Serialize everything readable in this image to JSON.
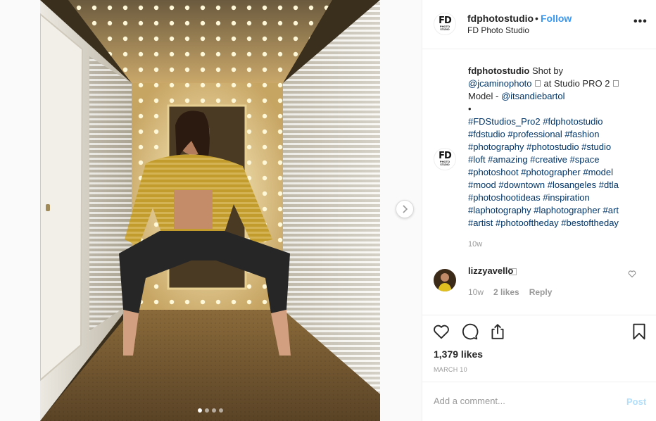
{
  "post": {
    "username": "fdphotostudio",
    "bullet": "•",
    "follow": "Follow",
    "full_name": "FD Photo Studio",
    "more": "•••",
    "avatar_text": {
      "big": "FD",
      "line1": "PHOTO",
      "line2": "STUDIO"
    }
  },
  "caption": {
    "username": "fdphotostudio",
    "text_lines": [
      {
        "pre": " Shot by",
        "link": "",
        "post": ""
      },
      {
        "pre": "",
        "link": "@jcaminophoto",
        "post": " ⃞ at Studio PRO 2 ⃞"
      },
      {
        "pre": "Model - ",
        "link": "@itsandiebartol",
        "post": ""
      },
      {
        "pre": "•",
        "link": "",
        "post": ""
      },
      {
        "pre": "",
        "link": "#FDStudios_Pro2 #fdphotostudio",
        "post": ""
      },
      {
        "pre": "",
        "link": "#fdstudio #professional #fashion",
        "post": ""
      },
      {
        "pre": "",
        "link": "#photography #photostudio #studio",
        "post": ""
      },
      {
        "pre": "",
        "link": "#loft #amazing #creative #space",
        "post": ""
      },
      {
        "pre": "",
        "link": "#photoshoot #photographer #model",
        "post": ""
      },
      {
        "pre": "",
        "link": "#mood #downtown #losangeles #dtla",
        "post": ""
      },
      {
        "pre": "",
        "link": "#photoshootideas #inspiration",
        "post": ""
      },
      {
        "pre": "",
        "link": "#laphotography #laphotographer #art",
        "post": ""
      },
      {
        "pre": "",
        "link": "#artist #photooftheday #bestoftheday",
        "post": ""
      }
    ],
    "time": "10w"
  },
  "comment": {
    "username": "lizzyavello",
    "text": "⃞",
    "time": "10w",
    "likes": "2 likes",
    "reply": "Reply"
  },
  "actions": {
    "icons": [
      "heart-icon",
      "comment-icon",
      "share-icon",
      "bookmark-icon"
    ]
  },
  "likes": "1,379 likes",
  "date": "MARCH 10",
  "comment_box": {
    "placeholder": "Add a comment...",
    "post": "Post"
  },
  "carousel": {
    "count": 4,
    "active": 1
  },
  "colors": {
    "link": "#003569",
    "follow": "#3897f0",
    "post_disabled": "#b2dffc",
    "muted": "#999999"
  }
}
